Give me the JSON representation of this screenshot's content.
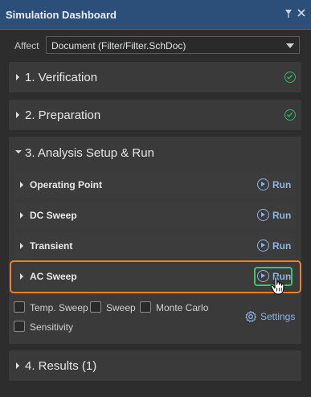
{
  "window": {
    "title": "Simulation Dashboard",
    "pin_icon": "pin-icon",
    "close_icon": "close-icon"
  },
  "affect": {
    "label": "Affect",
    "value": "Document (Filter/Filter.SchDoc)"
  },
  "sections": [
    {
      "label": "1. Verification",
      "expanded": false,
      "status": "complete"
    },
    {
      "label": "2. Preparation",
      "expanded": false,
      "status": "complete"
    },
    {
      "label": "3. Analysis Setup & Run",
      "expanded": true
    },
    {
      "label": "4. Results (1)",
      "expanded": false
    }
  ],
  "analyses": [
    {
      "label": "Operating Point",
      "run_label": "Run"
    },
    {
      "label": "DC Sweep",
      "run_label": "Run"
    },
    {
      "label": "Transient",
      "run_label": "Run"
    },
    {
      "label": "AC Sweep",
      "run_label": "Run"
    }
  ],
  "options": [
    {
      "label": "Temp. Sweep",
      "checked": false
    },
    {
      "label": "Sweep",
      "checked": false
    },
    {
      "label": "Monte Carlo",
      "checked": false
    },
    {
      "label": "Sensitivity",
      "checked": false
    }
  ],
  "settings_label": "Settings",
  "colors": {
    "title_bar": "#2b4f78",
    "link_blue": "#8ab4e6",
    "check_green": "#35b36a",
    "highlight_orange": "#e8822a",
    "run_highlight_green": "#3fc46a"
  }
}
